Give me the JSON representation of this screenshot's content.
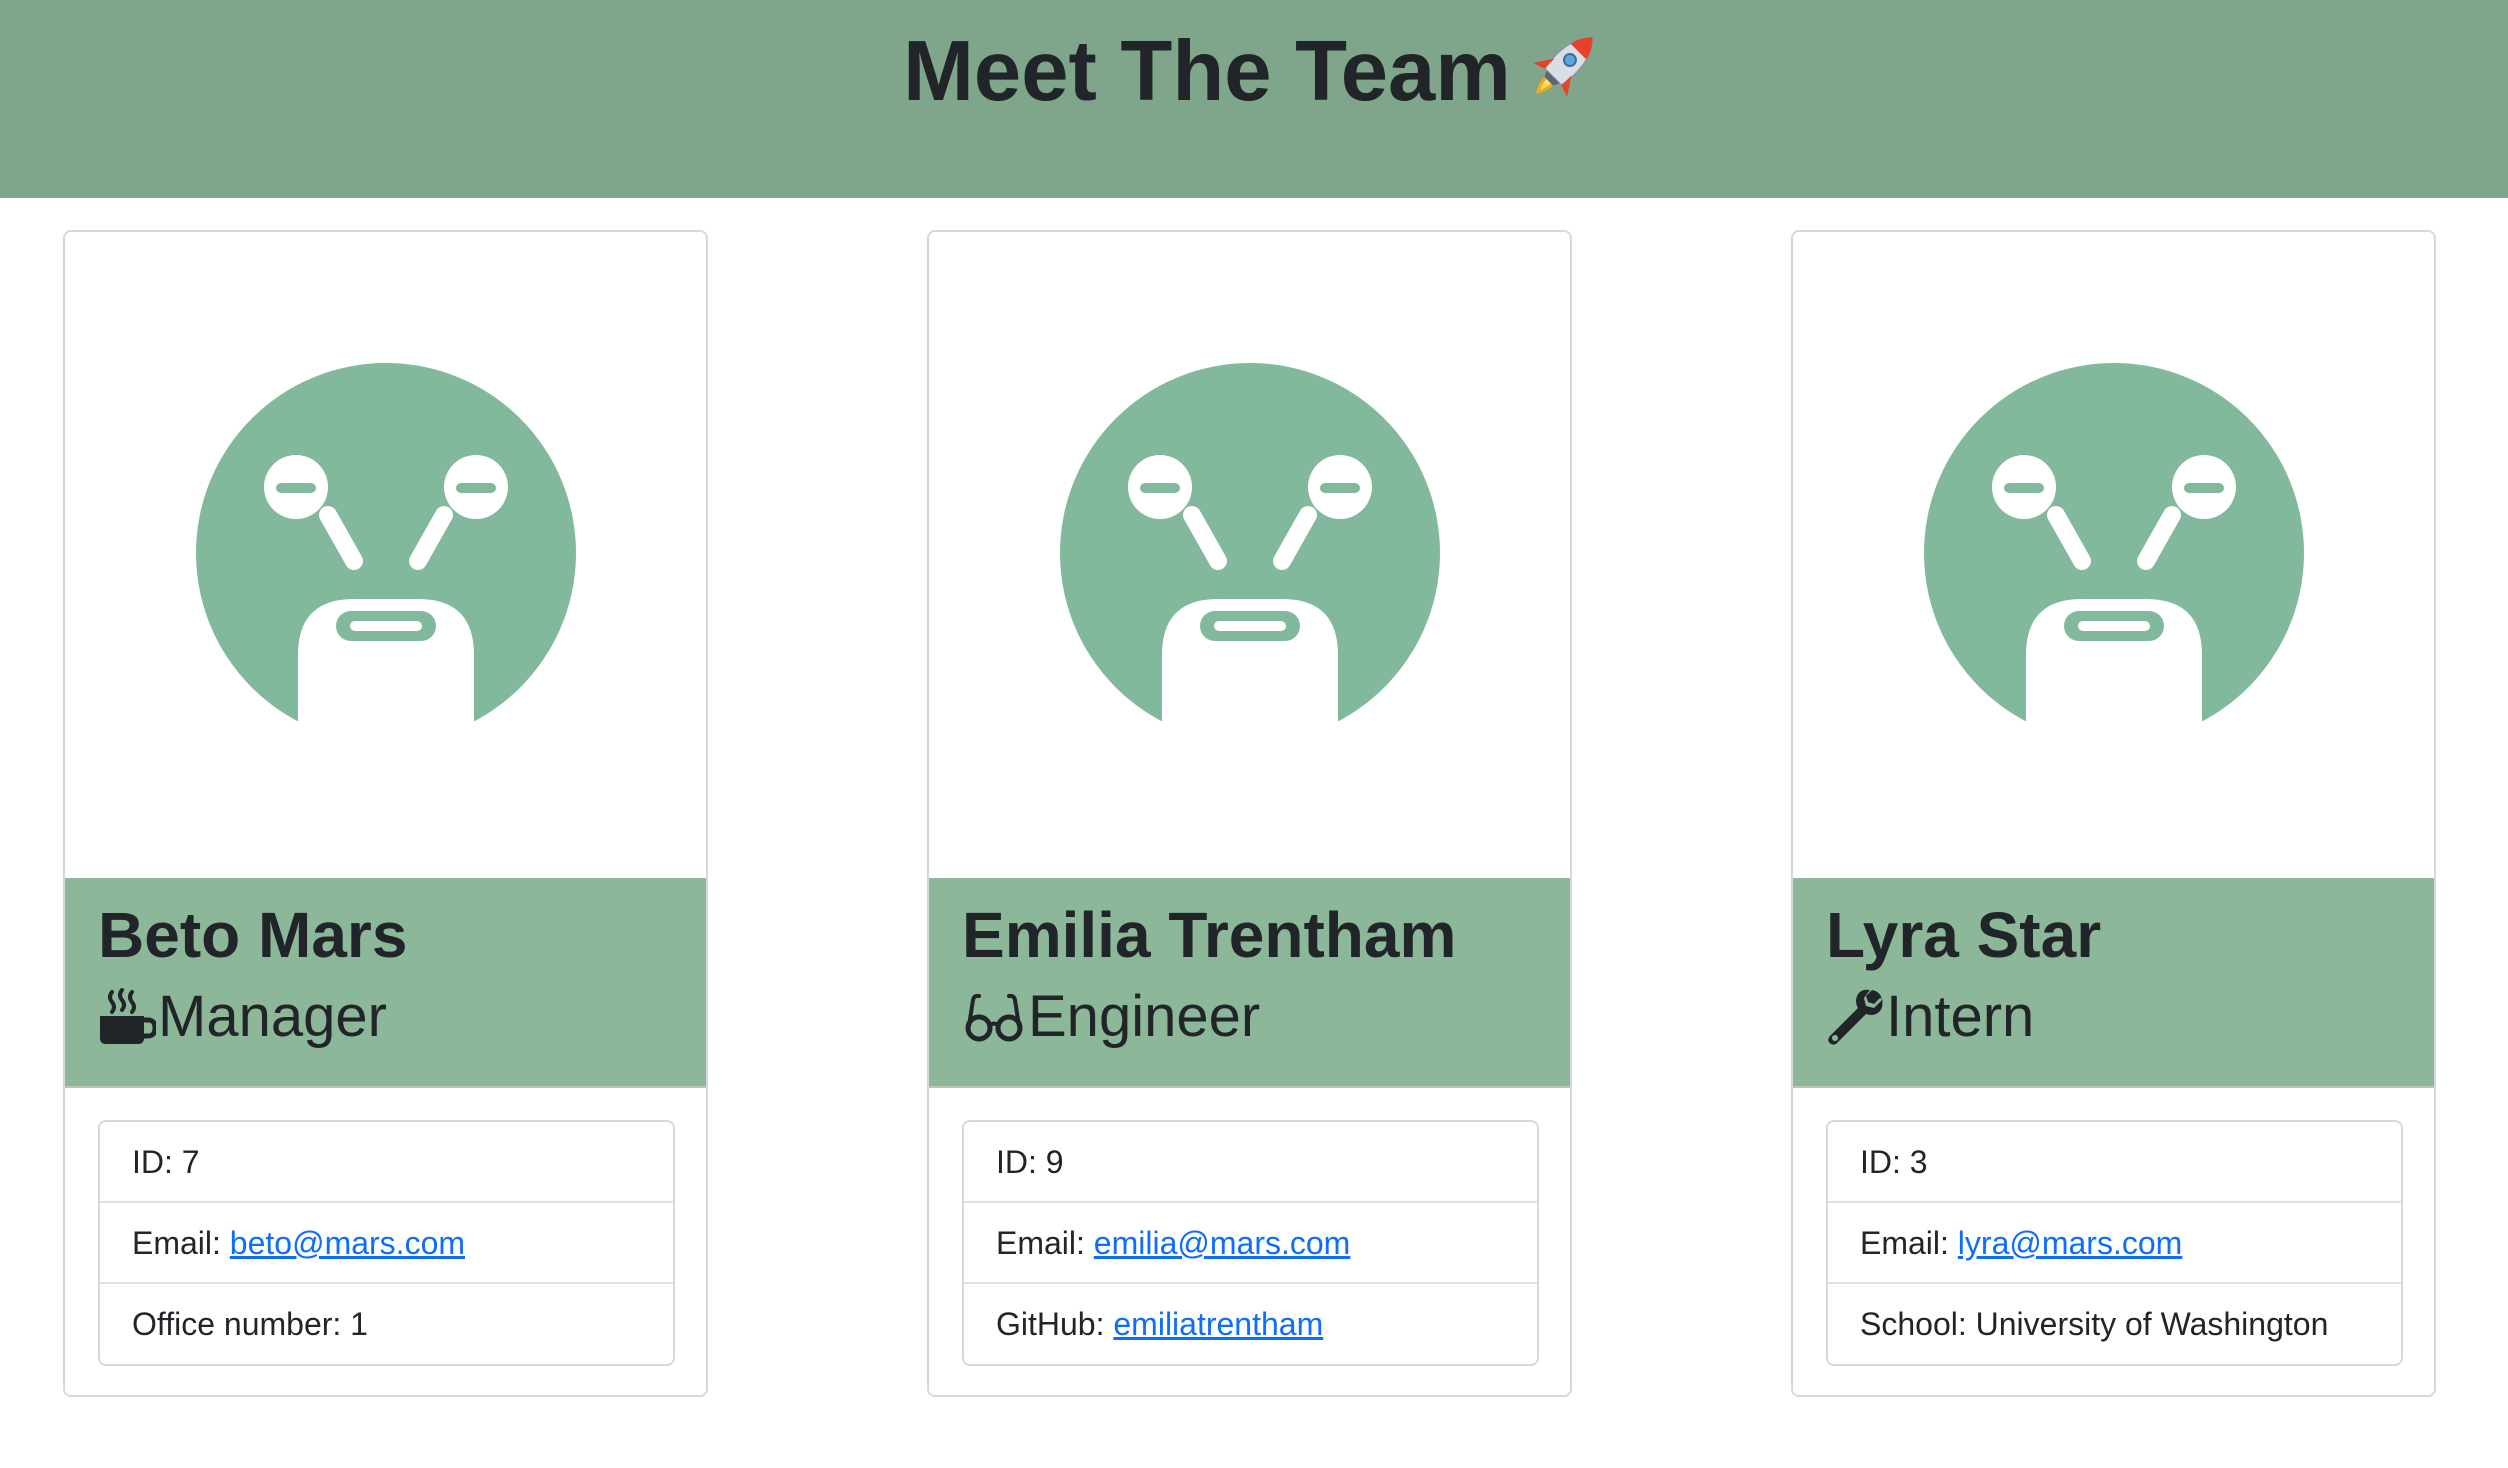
{
  "header": {
    "title": "Meet The Team",
    "emoji_icon": "rocket-icon"
  },
  "colors": {
    "header_bg": "#7fa58b",
    "card_header_bg": "#8db799",
    "avatar_green": "#82b99d",
    "link": "#0d6efd"
  },
  "team": [
    {
      "name": "Beto Mars",
      "role": "Manager",
      "role_icon": "coffee-mug-icon",
      "id_label": "ID: 7",
      "email_label": "Email: ",
      "email": "beto@mars.com",
      "extra_label": "Office number: ",
      "extra_value": "1"
    },
    {
      "name": "Emilia Trentham",
      "role": "Engineer",
      "role_icon": "glasses-icon",
      "id_label": "ID: 9",
      "email_label": "Email: ",
      "email": "emilia@mars.com",
      "extra_label": "GitHub: ",
      "extra_value": "emiliatrentham"
    },
    {
      "name": "Lyra Star",
      "role": "Intern",
      "role_icon": "wrench-icon",
      "id_label": "ID: 3",
      "email_label": "Email: ",
      "email": "lyra@mars.com",
      "extra_label": "School: ",
      "extra_value": "University of Washington"
    }
  ]
}
